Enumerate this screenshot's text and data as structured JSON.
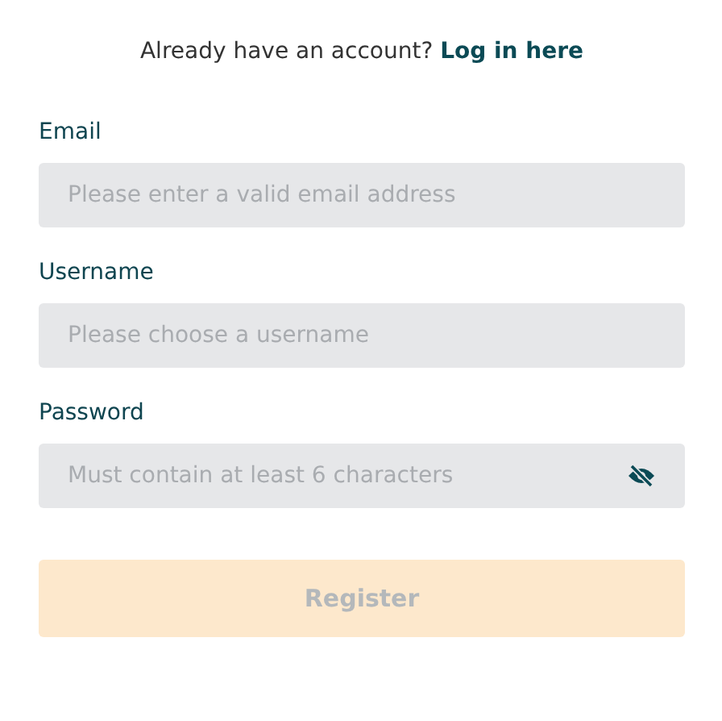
{
  "login_prompt": {
    "text": "Already have an account?",
    "link": "Log in here"
  },
  "fields": [
    {
      "label": "Email",
      "placeholder": "Please enter a valid email address",
      "kind": "text"
    },
    {
      "label": "Username",
      "placeholder": "Please choose a username",
      "kind": "text"
    },
    {
      "label": "Password",
      "placeholder": "Must contain at least 6 characters",
      "kind": "password"
    }
  ],
  "register_button": {
    "label": "Register",
    "disabled": true
  }
}
